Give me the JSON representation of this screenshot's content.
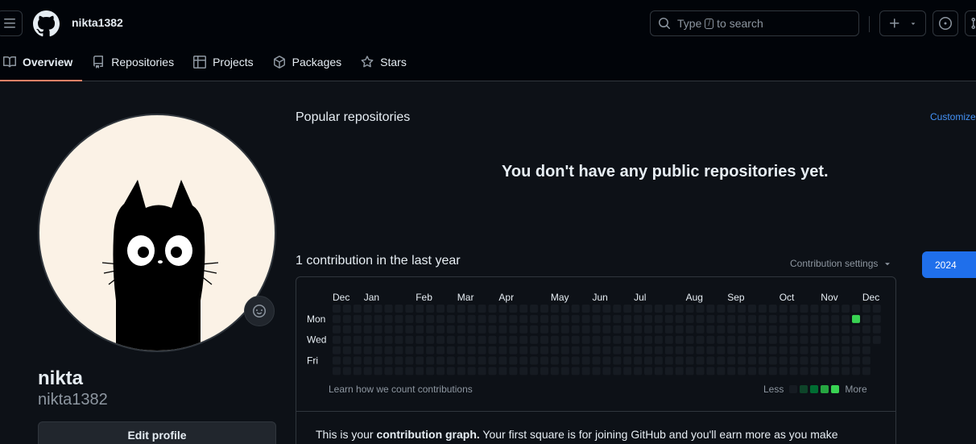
{
  "header": {
    "username": "nikta1382",
    "search": {
      "prefix": "Type",
      "key": "/",
      "suffix": "to search"
    }
  },
  "tabs": [
    {
      "label": "Overview",
      "icon": "book-icon"
    },
    {
      "label": "Repositories",
      "icon": "repo-icon"
    },
    {
      "label": "Projects",
      "icon": "table-icon"
    },
    {
      "label": "Packages",
      "icon": "package-icon"
    },
    {
      "label": "Stars",
      "icon": "star-icon"
    }
  ],
  "profile": {
    "name": "nikta",
    "login": "nikta1382",
    "edit_label": "Edit profile"
  },
  "popular": {
    "title": "Popular repositories",
    "customize": "Customize",
    "empty": "You don't have any public repositories yet."
  },
  "contributions": {
    "title": "1 contribution in the last year",
    "settings": "Contribution settings",
    "year": "2024",
    "months": [
      "Dec",
      "Jan",
      "Feb",
      "Mar",
      "Apr",
      "May",
      "Jun",
      "Jul",
      "Aug",
      "Sep",
      "Oct",
      "Nov",
      "Dec"
    ],
    "days": [
      "Mon",
      "Wed",
      "Fri"
    ],
    "learn": "Learn how we count contributions",
    "less": "Less",
    "more": "More",
    "weeks": 53,
    "active_cell": {
      "week": 50,
      "day": 1,
      "level": 4
    },
    "levels": [
      "#161b22",
      "#0e4429",
      "#006d32",
      "#26a641",
      "#39d353"
    ],
    "info_pre": "This is your ",
    "info_bold": "contribution graph.",
    "info_post": " Your first square is for joining GitHub and you'll earn more as you make"
  },
  "colors": {
    "accent": "#1f6feb",
    "link": "#4493f8",
    "tab_underline": "#f78166"
  }
}
